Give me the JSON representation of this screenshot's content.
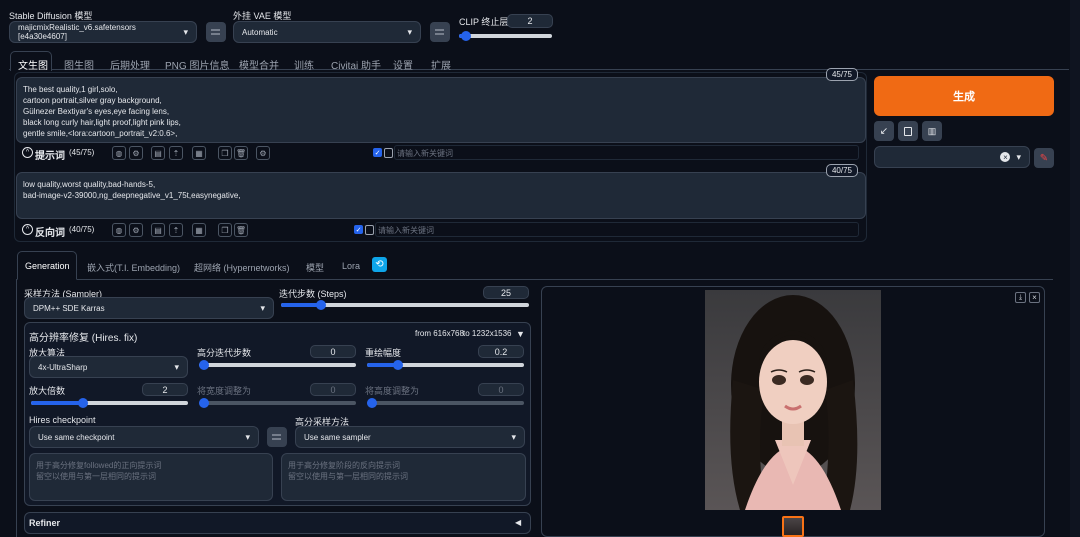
{
  "top": {
    "sd_model_label": "Stable Diffusion 模型",
    "sd_model_value": "majicmixRealistic_v6.safetensors [e4a30e4607]",
    "vae_label": "外挂 VAE 模型",
    "vae_value": "Automatic",
    "clip_label": "CLIP 终止层数",
    "clip_value": "2",
    "clip_fraction": 0.08
  },
  "tabs": [
    "文生图",
    "图生图",
    "后期处理",
    "PNG 图片信息",
    "模型合并",
    "训练",
    "Civitai 助手",
    "设置",
    "扩展"
  ],
  "prompt": {
    "counter": "45/75",
    "lines": [
      "The best quality,1 girl,solo,",
      "cartoon portrait,silver gray background,",
      "Gülnezer Bextiyar's eyes,eye facing lens,",
      "black long curly hair,light proof,light pink lips,",
      "gentle smile,<lora:cartoon_portrait_v2:0.6>,"
    ],
    "toolbar_label": "提示词",
    "toolbar_count": "(45/75)",
    "keyword_placeholder": "请输入新关键词"
  },
  "negative": {
    "counter": "40/75",
    "lines": [
      "low quality,worst quality,bad-hands-5,",
      "bad-image-v2-39000,ng_deepnegative_v1_75t,easynegative,"
    ],
    "toolbar_label": "反向词",
    "toolbar_count": "(40/75)",
    "keyword_placeholder": "请输入新关键词"
  },
  "generate": {
    "label": "生成",
    "accent": "#f06a14"
  },
  "subtabs": [
    "Generation",
    "嵌入式(T.I. Embedding)",
    "超网络 (Hypernetworks)",
    "模型",
    "Lora"
  ],
  "sampler": {
    "label": "采样方法 (Sampler)",
    "value": "DPM++ SDE Karras"
  },
  "steps": {
    "label": "迭代步数 (Steps)",
    "value": "25",
    "fraction": 0.16
  },
  "hires": {
    "title": "高分辨率修复 (Hires. fix)",
    "from_label": "from 616x768",
    "to_label": "to 1232x1536",
    "upscaler_label": "放大算法",
    "upscaler_value": "4x-UltraSharp",
    "hires_steps_label": "高分迭代步数",
    "hires_steps_value": "0",
    "hires_steps_fraction": 0,
    "denoise_label": "重绘幅度",
    "denoise_value": "0.2",
    "denoise_fraction": 0.2,
    "scale_label": "放大倍数",
    "scale_value": "2",
    "scale_fraction": 0.33,
    "width_label": "将宽度调整为",
    "width_value": "0",
    "height_label": "将高度调整为",
    "height_value": "0",
    "checkpoint_label": "Hires checkpoint",
    "checkpoint_value": "Use same checkpoint",
    "sampler_label": "高分采样方法",
    "sampler_value": "Use same sampler",
    "pos_placeholder_1": "用于高分修复followed的正向提示词",
    "pos_placeholder_2": "留空以使用与第一层相同的提示词",
    "neg_placeholder_1": "用于高分修复阶段的反向提示词",
    "neg_placeholder_2": "留空以使用与第一层相同的提示词"
  },
  "refiner": {
    "label": "Refiner"
  }
}
